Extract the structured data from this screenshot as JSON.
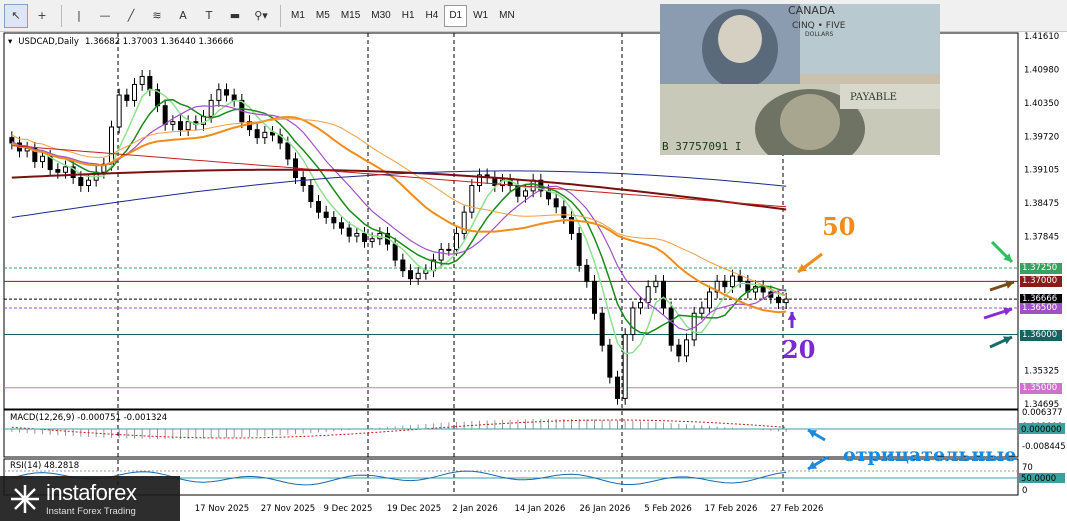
{
  "toolbar": {
    "tools": [
      {
        "name": "cursor-icon",
        "glyph": "↖"
      },
      {
        "name": "crosshair-icon",
        "glyph": "+"
      },
      {
        "name": "vertical-line-icon",
        "glyph": "|"
      },
      {
        "name": "horizontal-line-icon",
        "glyph": "—"
      },
      {
        "name": "trendline-icon",
        "glyph": "╱"
      },
      {
        "name": "fibonacci-icon",
        "glyph": "≋"
      },
      {
        "name": "text-icon",
        "glyph": "A"
      },
      {
        "name": "text-label-icon",
        "glyph": "T"
      },
      {
        "name": "rectangle-icon",
        "glyph": "▬"
      },
      {
        "name": "shapes-menu-icon",
        "glyph": "⚲▾"
      }
    ],
    "timeframes": [
      "M1",
      "M5",
      "M15",
      "M30",
      "H1",
      "H4",
      "D1",
      "W1",
      "MN"
    ],
    "active_timeframe": "D1"
  },
  "info": {
    "symbol": "USDCAD,Daily",
    "ohlc": "1.36682 1.37003 1.36440 1.36666"
  },
  "price_axis": [
    "1.41610",
    "1.40980",
    "1.40350",
    "1.39720",
    "1.39105",
    "1.38475",
    "1.37845",
    "1.36666",
    "1.35325",
    "1.34695"
  ],
  "price_tags": [
    {
      "label": "1.37250",
      "value": 1.3725,
      "color": "#3aa060"
    },
    {
      "label": "1.37000",
      "value": 1.37,
      "color": "#8b1a1a"
    },
    {
      "label": "1.36666",
      "value": 1.36666,
      "color": "#000000"
    },
    {
      "label": "1.36500",
      "value": 1.365,
      "color": "#a050c8"
    },
    {
      "label": "1.36000",
      "value": 1.36,
      "color": "#1a6060"
    },
    {
      "label": "1.35000",
      "value": 1.35,
      "color": "#d070d0"
    }
  ],
  "macd": {
    "label": "MACD(12,26,9) -0.000751 -0.001324",
    "axis": [
      "0.006377",
      "0.000000",
      "-0.008445"
    ]
  },
  "rsi": {
    "label": "RSI(14) 48.2818",
    "axis": [
      "70",
      "50.0000",
      "0"
    ]
  },
  "dates": [
    "17 Nov 2025",
    "27 Nov 2025",
    "9 Dec 2025",
    "19 Dec 2025",
    "2 Jan 2026",
    "14 Jan 2026",
    "26 Jan 2026",
    "5 Feb 2026",
    "17 Feb 2026",
    "27 Feb 2026"
  ],
  "annotations": {
    "ma50": "50",
    "ma20": "20",
    "negative": "отрицательные"
  },
  "logo": {
    "name": "instaforex",
    "tagline": "Instant Forex Trading"
  },
  "banknote": {
    "top_text": "CANADA",
    "sub_text": "CINQ • FIVE",
    "dollars": "DOLLARS",
    "serial": "B 37757091 I"
  },
  "colors": {
    "candle": "#000000",
    "sma20": "#1a8a1a",
    "sma10": "#90e090",
    "ma_orange": "#f08c1a",
    "ma_maroon": "#7a1010",
    "ma_navy": "#1a2a8a",
    "ma_violet": "#a050c8",
    "ma_red": "#c02020"
  }
}
